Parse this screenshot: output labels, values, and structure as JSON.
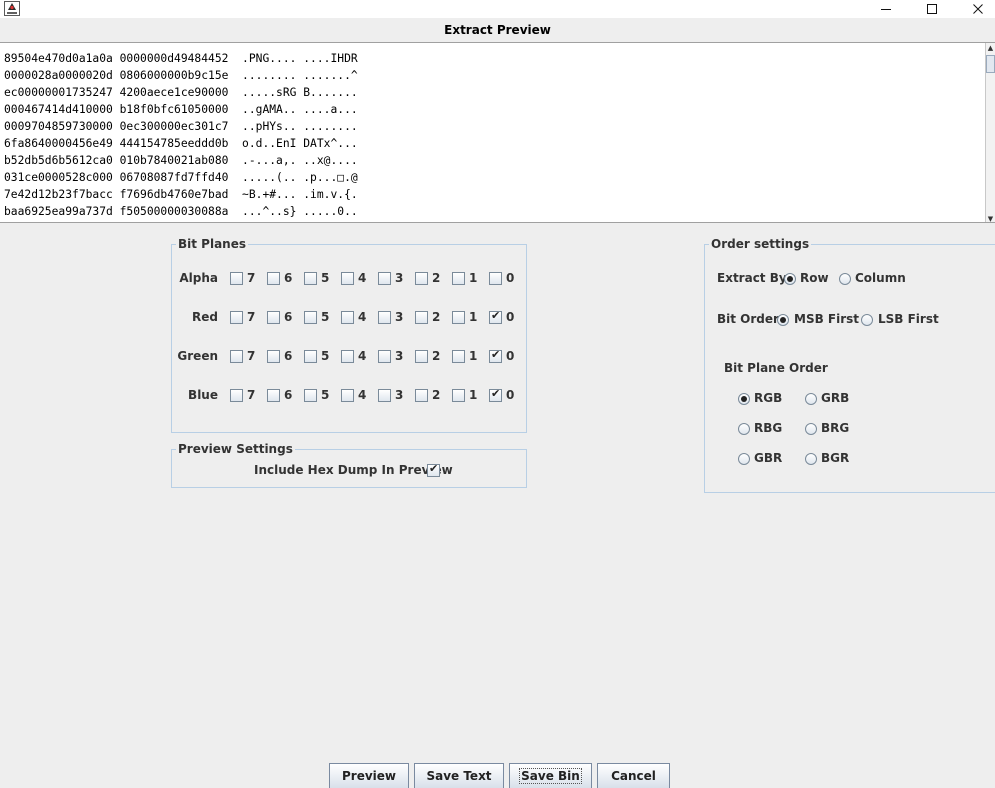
{
  "window": {
    "title": "Extract Preview",
    "icon": "java-duke-icon"
  },
  "hex_dump": {
    "lines": [
      "89504e470d0a1a0a 0000000d49484452  .PNG.... ....IHDR",
      "0000028a0000020d 0806000000b9c15e  ........ .......^",
      "ec00000001735247 4200aece1ce90000  .....sRG B.......",
      "000467414d410000 b18f0bfc61050000  ..gAMA.. ....a...",
      "0009704859730000 0ec300000ec301c7  ..pHYs.. ........",
      "6fa8640000456e49 444154785eeddd0b  o.d..EnI DATx^...",
      "b52db5d6b5612ca0 010b7840021ab080  .-...a,. ..x@....",
      "031ce0000528c000 06708087fd7ffd40  .....(.. .p...□.@",
      "7e42d12b23f7bacc f7696db4760e7bad  ~B.+#... .im.v.{.",
      "baa6925ea99a737d f50500000030088a  ...^..s} .....0.."
    ]
  },
  "bit_planes": {
    "title": "Bit Planes",
    "bits": [
      "7",
      "6",
      "5",
      "4",
      "3",
      "2",
      "1",
      "0"
    ],
    "channels": [
      {
        "label": "Alpha",
        "checked": [
          false,
          false,
          false,
          false,
          false,
          false,
          false,
          false
        ]
      },
      {
        "label": "Red",
        "checked": [
          false,
          false,
          false,
          false,
          false,
          false,
          false,
          true
        ]
      },
      {
        "label": "Green",
        "checked": [
          false,
          false,
          false,
          false,
          false,
          false,
          false,
          true
        ]
      },
      {
        "label": "Blue",
        "checked": [
          false,
          false,
          false,
          false,
          false,
          false,
          false,
          true
        ]
      }
    ]
  },
  "preview_settings": {
    "title": "Preview Settings",
    "include_hex_label": "Include Hex Dump In Preview",
    "include_hex_checked": true
  },
  "order_settings": {
    "title": "Order settings",
    "extract_by_label": "Extract By",
    "extract_by_options": [
      "Row",
      "Column"
    ],
    "extract_by_selected": "Row",
    "bit_order_label": "Bit Order",
    "bit_order_options": [
      "MSB First",
      "LSB First"
    ],
    "bit_order_selected": "MSB First",
    "bit_plane_order_label": "Bit Plane Order",
    "bit_plane_order_options": [
      "RGB",
      "GRB",
      "RBG",
      "BRG",
      "GBR",
      "BGR"
    ],
    "bit_plane_order_selected": "RGB"
  },
  "buttons": {
    "preview": "Preview",
    "save_text": "Save Text",
    "save_bin": "Save Bin",
    "cancel": "Cancel"
  }
}
